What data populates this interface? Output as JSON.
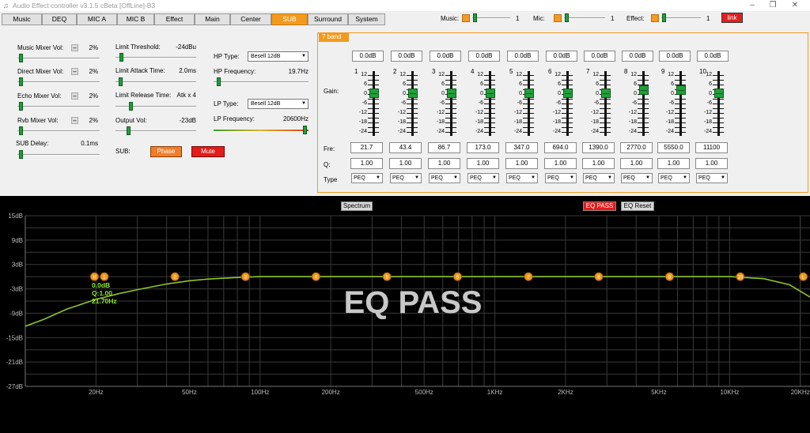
{
  "window": {
    "title": "Audio Effect controller v3.1.5 cBeta [OffLine]-B3"
  },
  "tabs": [
    "Music",
    "DEQ",
    "MIC A",
    "MIC B",
    "Effect",
    "Main",
    "Center",
    "SUB",
    "Surround",
    "System"
  ],
  "active_tab": "SUB",
  "top_controls": {
    "music": {
      "label": "Music:",
      "value": "1"
    },
    "mic": {
      "label": "Mic:",
      "value": "1"
    },
    "effect": {
      "label": "Effect:",
      "value": "1"
    },
    "link_label": "link"
  },
  "left": {
    "music_mixer": {
      "label": "Music Mixer Vol:",
      "value": "2%"
    },
    "direct_mixer": {
      "label": "Direct Mixer Vol:",
      "value": "2%"
    },
    "echo_mixer": {
      "label": "Echo Mixer Vol:",
      "value": "2%"
    },
    "rvb_mixer": {
      "label": "Rvb Mixer Vol:",
      "value": "2%"
    },
    "sub_delay": {
      "label": "SUB Delay:",
      "value": "0.1ms"
    },
    "limit_threshold": {
      "label": "Limit Threshold:",
      "value": "-24dBu"
    },
    "limit_attack": {
      "label": "Limit Attack Time:",
      "value": "2.0ms"
    },
    "limit_release": {
      "label": "Limit Release Time:",
      "value": "Atk x 4"
    },
    "output_vol": {
      "label": "Output Vol:",
      "value": "-23dB"
    },
    "sub_label": "SUB:",
    "phase_label": "Phase",
    "mute_label": "Mute",
    "hp_type": {
      "label": "HP Type:",
      "value": "Besell 12dB"
    },
    "hp_freq": {
      "label": "HP Frequency:",
      "value": "19.7Hz"
    },
    "lp_type": {
      "label": "LP Type:",
      "value": "Besell 12dB"
    },
    "lp_freq": {
      "label": "LP Frequency:",
      "value": "20600Hz"
    }
  },
  "eq": {
    "title": "7 band",
    "gain_label": "Gain:",
    "fre_label": "Fre:",
    "q_label": "Q:",
    "type_label": "Type",
    "scale": [
      "12",
      "6",
      "0",
      "-6",
      "-12",
      "-18",
      "-24"
    ],
    "bands": [
      {
        "num": "1",
        "gain": "0.0dB",
        "freq": "21.7",
        "q": "1.00",
        "type": "PEQ"
      },
      {
        "num": "2",
        "gain": "0.0dB",
        "freq": "43.4",
        "q": "1.00",
        "type": "PEQ"
      },
      {
        "num": "3",
        "gain": "0.0dB",
        "freq": "86.7",
        "q": "1.00",
        "type": "PEQ"
      },
      {
        "num": "4",
        "gain": "0.0dB",
        "freq": "173.0",
        "q": "1.00",
        "type": "PEQ"
      },
      {
        "num": "5",
        "gain": "0.0dB",
        "freq": "347.0",
        "q": "1.00",
        "type": "PEQ"
      },
      {
        "num": "6",
        "gain": "0.0dB",
        "freq": "694.0",
        "q": "1.00",
        "type": "PEQ"
      },
      {
        "num": "7",
        "gain": "0.0dB",
        "freq": "1390.0",
        "q": "1.00",
        "type": "PEQ"
      },
      {
        "num": "8",
        "gain": "0.0dB",
        "freq": "2770.0",
        "q": "1.00",
        "type": "PEQ"
      },
      {
        "num": "9",
        "gain": "0.0dB",
        "freq": "5550.0",
        "q": "1.00",
        "type": "PEQ"
      },
      {
        "num": "10",
        "gain": "0.0dB",
        "freq": "11100",
        "q": "1.00",
        "type": "PEQ"
      }
    ]
  },
  "graph": {
    "spectrum_label": "Spectrum",
    "eq_pass_label": "EQ PASS",
    "eq_reset_label": "EQ Reset",
    "overlay_text": "EQ PASS",
    "readout": [
      "0.0dB",
      "Q:1.00",
      "21.70Hz"
    ],
    "point_labels": [
      "H",
      "1",
      "2",
      "3",
      "4",
      "5",
      "6",
      "7",
      "8",
      "9",
      "10",
      "L"
    ],
    "colors": {
      "curve": "#8fc42a",
      "point": "#f29a1d",
      "grid": "#3a3a3a",
      "readout": "#8fe82a"
    }
  },
  "chart_data": {
    "type": "line",
    "ylim": [
      -27,
      15
    ],
    "y_ticks": [
      15,
      9,
      3,
      -3,
      -9,
      -15,
      -21,
      -27
    ],
    "y_tick_labels": [
      "15dB",
      "9dB",
      "3dB",
      "-3dB",
      "-9dB",
      "-15dB",
      "-21dB",
      "-27dB"
    ],
    "x_scale": "log",
    "xlim": [
      10,
      22000
    ],
    "x_ticks": [
      20,
      50,
      100,
      200,
      500,
      1000,
      2000,
      5000,
      10000,
      20000
    ],
    "x_tick_labels": [
      "20Hz",
      "50Hz",
      "100Hz",
      "200Hz",
      "500Hz",
      "1KHz",
      "2KHz",
      "5KHz",
      "10KHz",
      "20KHz"
    ],
    "series": [
      {
        "x": [
          10,
          12,
          15,
          20,
          25,
          30,
          40,
          50,
          60,
          80,
          100,
          200,
          1000,
          5000,
          10000,
          14000,
          18000,
          22000
        ],
        "y": [
          -12.2,
          -10.5,
          -8.0,
          -5.6,
          -4.2,
          -3.2,
          -1.8,
          -1.0,
          -0.6,
          -0.2,
          0.0,
          0.0,
          0.0,
          0.0,
          0.0,
          -0.5,
          -2.0,
          -5.0
        ]
      }
    ],
    "points": [
      {
        "label": "H",
        "x": 19.7,
        "y": 0
      },
      {
        "label": "1",
        "x": 21.7,
        "y": 0
      },
      {
        "label": "2",
        "x": 43.4,
        "y": 0
      },
      {
        "label": "3",
        "x": 86.7,
        "y": 0
      },
      {
        "label": "4",
        "x": 173.0,
        "y": 0
      },
      {
        "label": "5",
        "x": 347.0,
        "y": 0
      },
      {
        "label": "6",
        "x": 694.0,
        "y": 0
      },
      {
        "label": "7",
        "x": 1390.0,
        "y": 0
      },
      {
        "label": "8",
        "x": 2770.0,
        "y": 0
      },
      {
        "label": "9",
        "x": 5550.0,
        "y": 0
      },
      {
        "label": "10",
        "x": 11100,
        "y": 0
      },
      {
        "label": "L",
        "x": 20600,
        "y": 0
      }
    ]
  }
}
